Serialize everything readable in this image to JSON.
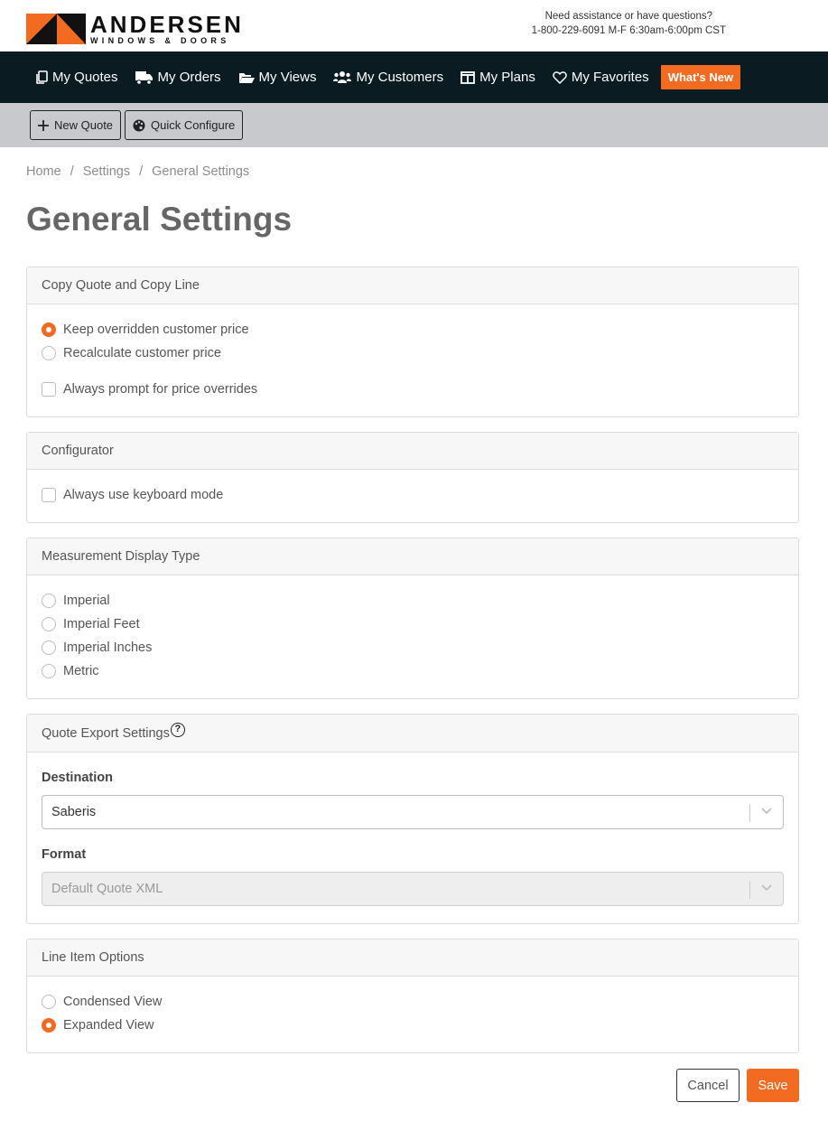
{
  "brand": {
    "name": "ANDERSEN",
    "tagline": "WINDOWS & DOORS",
    "accent": "#f26b21",
    "nav_bg": "#0b1b22"
  },
  "assist": {
    "line1": "Need assistance or have questions?",
    "line2": "1-800-229-6091 M-F 6:30am-6:00pm CST"
  },
  "nav": {
    "items": [
      {
        "label": "My Quotes",
        "icon": "copy-icon"
      },
      {
        "label": "My Orders",
        "icon": "truck-icon"
      },
      {
        "label": "My Views",
        "icon": "folder-open-icon"
      },
      {
        "label": "My Customers",
        "icon": "users-icon"
      },
      {
        "label": "My Plans",
        "icon": "columns-icon"
      },
      {
        "label": "My Favorites",
        "icon": "heart-icon"
      }
    ],
    "whats_new": "What's New"
  },
  "toolbar": {
    "new_quote": "New Quote",
    "quick_configure": "Quick Configure"
  },
  "breadcrumb": {
    "home": "Home",
    "settings": "Settings",
    "current": "General Settings",
    "sep": "/"
  },
  "page_title": "General Settings",
  "copy_quote": {
    "title": "Copy Quote and Copy Line",
    "keep": "Keep overridden customer price",
    "recalc": "Recalculate customer price",
    "prompt": "Always prompt for price overrides",
    "selected": "keep",
    "prompt_checked": false
  },
  "configurator": {
    "title": "Configurator",
    "keyboard": "Always use keyboard mode",
    "keyboard_checked": false
  },
  "measurement": {
    "title": "Measurement Display Type",
    "options": [
      "Imperial",
      "Imperial Feet",
      "Imperial Inches",
      "Metric"
    ],
    "selected": null
  },
  "quote_export": {
    "title": "Quote Export Settings",
    "help_icon": "question-circle-icon",
    "destination_label": "Destination",
    "destination_value": "Saberis",
    "format_label": "Format",
    "format_placeholder": "Default Quote XML"
  },
  "line_item": {
    "title": "Line Item Options",
    "condensed": "Condensed View",
    "expanded": "Expanded View",
    "selected": "expanded"
  },
  "actions": {
    "cancel": "Cancel",
    "save": "Save"
  }
}
